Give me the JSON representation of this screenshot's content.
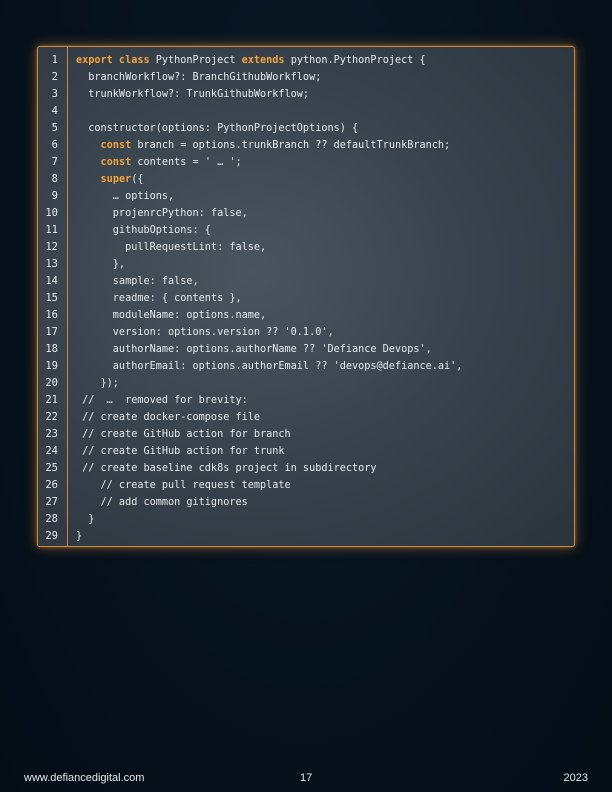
{
  "code": {
    "line_numbers": [
      "1",
      "2",
      "3",
      "4",
      "5",
      "6",
      "7",
      "8",
      "9",
      "10",
      "11",
      "12",
      "13",
      "14",
      "15",
      "16",
      "17",
      "18",
      "19",
      "20",
      "21",
      "22",
      "23",
      "24",
      "25",
      "26",
      "27",
      "28",
      "29"
    ],
    "lines": [
      [
        {
          "t": "kw",
          "v": "export class"
        },
        {
          "t": "plain",
          "v": " PythonProject "
        },
        {
          "t": "kw",
          "v": "extends"
        },
        {
          "t": "plain",
          "v": " python.PythonProject {"
        }
      ],
      [
        {
          "t": "plain",
          "v": "  branchWorkflow?: BranchGithubWorkflow;"
        }
      ],
      [
        {
          "t": "plain",
          "v": "  trunkWorkflow?: TrunkGithubWorkflow;"
        }
      ],
      [
        {
          "t": "plain",
          "v": ""
        }
      ],
      [
        {
          "t": "plain",
          "v": "  constructor(options: PythonProjectOptions) {"
        }
      ],
      [
        {
          "t": "plain",
          "v": "    "
        },
        {
          "t": "kw",
          "v": "const"
        },
        {
          "t": "plain",
          "v": " branch = options.trunkBranch ?? defaultTrunkBranch;"
        }
      ],
      [
        {
          "t": "plain",
          "v": "    "
        },
        {
          "t": "kw",
          "v": "const"
        },
        {
          "t": "plain",
          "v": " contents = ' … ';"
        }
      ],
      [
        {
          "t": "plain",
          "v": "    "
        },
        {
          "t": "kw",
          "v": "super"
        },
        {
          "t": "plain",
          "v": "({"
        }
      ],
      [
        {
          "t": "plain",
          "v": "      … options,"
        }
      ],
      [
        {
          "t": "plain",
          "v": "      projenrcPython: false,"
        }
      ],
      [
        {
          "t": "plain",
          "v": "      githubOptions: {"
        }
      ],
      [
        {
          "t": "plain",
          "v": "        pullRequestLint: false,"
        }
      ],
      [
        {
          "t": "plain",
          "v": "      },"
        }
      ],
      [
        {
          "t": "plain",
          "v": "      sample: false,"
        }
      ],
      [
        {
          "t": "plain",
          "v": "      readme: { contents },"
        }
      ],
      [
        {
          "t": "plain",
          "v": "      moduleName: options.name,"
        }
      ],
      [
        {
          "t": "plain",
          "v": "      version: options.version ?? '0.1.0',"
        }
      ],
      [
        {
          "t": "plain",
          "v": "      authorName: options.authorName ?? 'Defiance Devops',"
        }
      ],
      [
        {
          "t": "plain",
          "v": "      authorEmail: options.authorEmail ?? 'devops@defiance.ai',"
        }
      ],
      [
        {
          "t": "plain",
          "v": "    });"
        }
      ],
      [
        {
          "t": "plain",
          "v": " //  …  removed for brevity:"
        }
      ],
      [
        {
          "t": "plain",
          "v": " // create docker-compose file"
        }
      ],
      [
        {
          "t": "plain",
          "v": " // create GitHub action for branch"
        }
      ],
      [
        {
          "t": "plain",
          "v": " // create GitHub action for trunk"
        }
      ],
      [
        {
          "t": "plain",
          "v": " // create baseline cdk8s project in subdirectory"
        }
      ],
      [
        {
          "t": "plain",
          "v": "    // create pull request template"
        }
      ],
      [
        {
          "t": "plain",
          "v": "    // add common gitignores"
        }
      ],
      [
        {
          "t": "plain",
          "v": "  }"
        }
      ],
      [
        {
          "t": "plain",
          "v": "}"
        }
      ]
    ]
  },
  "footer": {
    "website": "www.defiancedigital.com",
    "page_number": "17",
    "year": "2023"
  },
  "colors": {
    "keyword": "#f2a43f",
    "border": "#c98a3c",
    "page_background": "#06111c"
  }
}
